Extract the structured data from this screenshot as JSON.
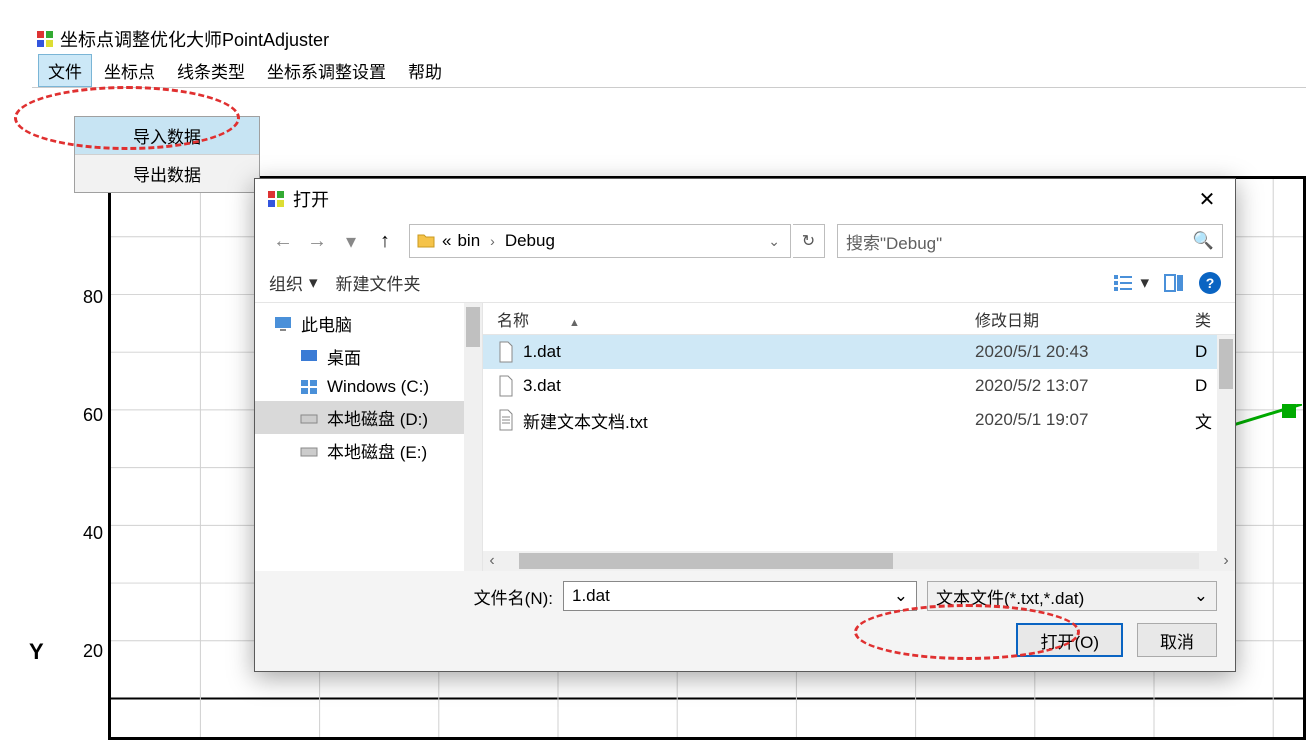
{
  "app": {
    "title": "坐标点调整优化大师PointAdjuster"
  },
  "menubar": {
    "file": "文件",
    "points": "坐标点",
    "linetype": "线条类型",
    "coord_settings": "坐标系调整设置",
    "help": "帮助"
  },
  "dropdown": {
    "import": "导入数据",
    "export": "导出数据"
  },
  "chart_data": {
    "type": "line",
    "y_ticks": [
      20,
      40,
      60,
      80
    ],
    "y_axis_label": "Y"
  },
  "dialog": {
    "title": "打开",
    "path_prefix": "«",
    "path_parts": [
      "bin",
      "Debug"
    ],
    "search_placeholder": "搜索\"Debug\"",
    "toolbar": {
      "organize": "组织",
      "new_folder": "新建文件夹"
    },
    "columns": {
      "name": "名称",
      "date": "修改日期",
      "type": "类"
    },
    "tree": {
      "this_pc": "此电脑",
      "desktop": "桌面",
      "c": "Windows (C:)",
      "d": "本地磁盘 (D:)",
      "e": "本地磁盘 (E:)"
    },
    "files": [
      {
        "name": "1.dat",
        "date": "2020/5/1 20:43",
        "type": "D"
      },
      {
        "name": "3.dat",
        "date": "2020/5/2 13:07",
        "type": "D"
      },
      {
        "name": "新建文本文档.txt",
        "date": "2020/5/1 19:07",
        "type": "文"
      }
    ],
    "filename_label": "文件名(N):",
    "filename_value": "1.dat",
    "filetype_value": "文本文件(*.txt,*.dat)",
    "open_btn": "打开(O)",
    "cancel_btn": "取消"
  }
}
